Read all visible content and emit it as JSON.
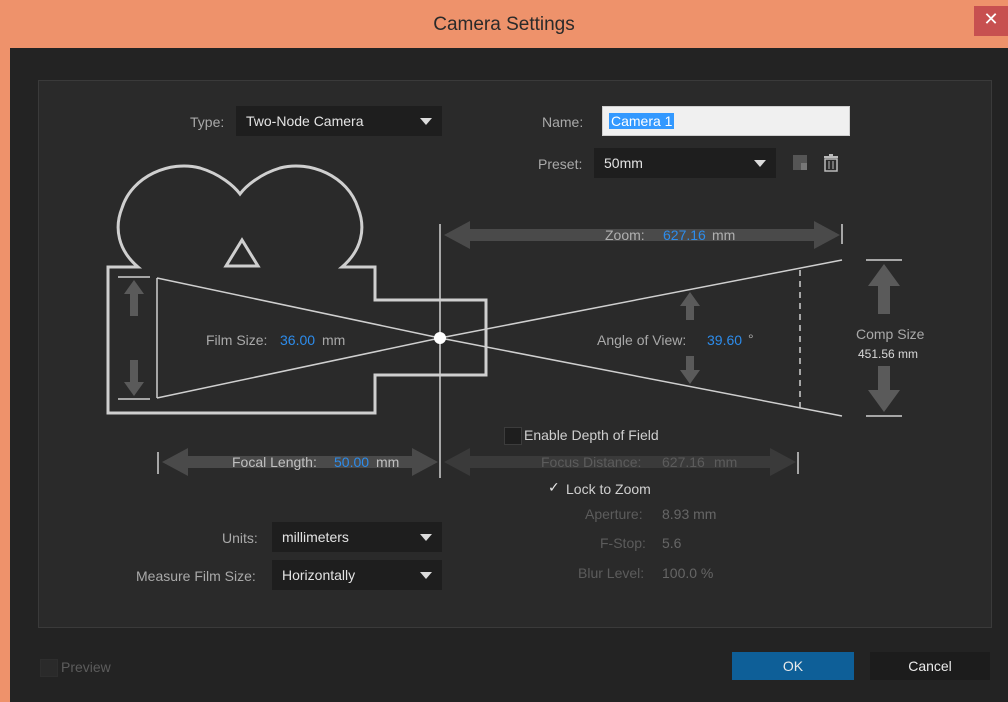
{
  "window": {
    "title": "Camera Settings",
    "close_glyph": "✕"
  },
  "type": {
    "label": "Type:",
    "value": "Two-Node Camera"
  },
  "name": {
    "label": "Name:",
    "value": "Camera 1"
  },
  "preset": {
    "label": "Preset:",
    "value": "50mm"
  },
  "zoom": {
    "label": "Zoom:",
    "value": "627.16",
    "unit": "mm"
  },
  "film_size": {
    "label": "Film Size:",
    "value": "36.00",
    "unit": "mm"
  },
  "angle_of_view": {
    "label": "Angle of View:",
    "value": "39.60",
    "unit": "°"
  },
  "comp_size": {
    "label": "Comp Size",
    "value": "451.56 mm"
  },
  "focal_length": {
    "label": "Focal Length:",
    "value": "50.00",
    "unit": "mm"
  },
  "depth_of_field": {
    "enable_label": "Enable Depth of Field"
  },
  "focus_distance": {
    "label": "Focus Distance:",
    "value": "627.16",
    "unit": "mm"
  },
  "lock_to_zoom": {
    "label": "Lock to Zoom",
    "checked": true
  },
  "aperture": {
    "label": "Aperture:",
    "value": "8.93 mm"
  },
  "fstop": {
    "label": "F-Stop:",
    "value": "5.6"
  },
  "blur_level": {
    "label": "Blur Level:",
    "value": "100.0 %"
  },
  "units": {
    "label": "Units:",
    "value": "millimeters"
  },
  "measure": {
    "label": "Measure Film Size:",
    "value": "Horizontally"
  },
  "footer": {
    "preview_label": "Preview",
    "ok_label": "OK",
    "cancel_label": "Cancel"
  },
  "colors": {
    "titlebar": "#ee926b",
    "ok_button": "#0e5f98",
    "value_blue": "#2d8ceb"
  },
  "icons": [
    "save-preset-icon",
    "trash-icon",
    "close-icon",
    "checkmark-icon",
    "camera-icon"
  ]
}
